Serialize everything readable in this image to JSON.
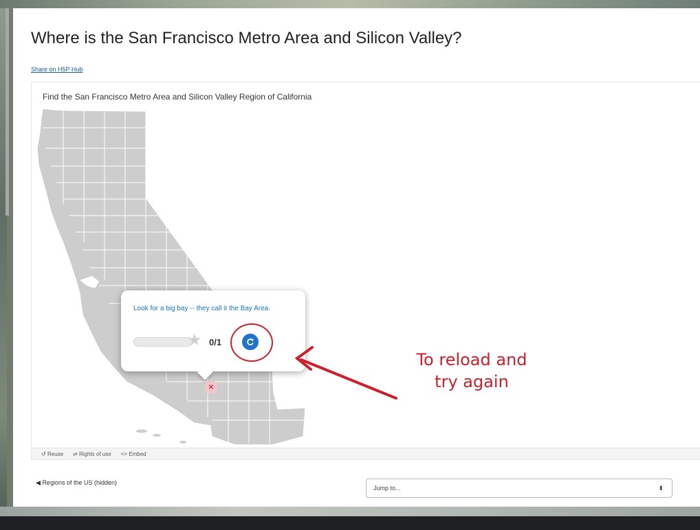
{
  "page": {
    "title": "Where is the San Francisco Metro Area and Silicon Valley?",
    "share_link": "Share on H5P Hub"
  },
  "h5p": {
    "task": "Find the San Francisco Metro Area and Silicon Valley Region of California",
    "map_icon": "california-counties-map",
    "marker_icon": "x-mark-icon",
    "popup": {
      "hint": "Look for a big bay -- they call it the Bay Area.",
      "score": "0/1",
      "progress_fraction": 0,
      "star_icon": "star-icon",
      "retry_icon": "retry-icon"
    },
    "footer": {
      "reuse": "Reuse",
      "rights": "Rights of use",
      "embed": "Embed"
    }
  },
  "annotation": {
    "line1": "To reload and",
    "line2": "try again",
    "color": "#c8202c"
  },
  "navigation": {
    "prev_label": "Regions of the US (hidden)",
    "jump_placeholder": "Jump to..."
  },
  "colors": {
    "accent": "#1f73c8",
    "map_fill": "#cdcdcd",
    "map_stroke": "#ffffff",
    "marker": "#f0c5cc"
  }
}
